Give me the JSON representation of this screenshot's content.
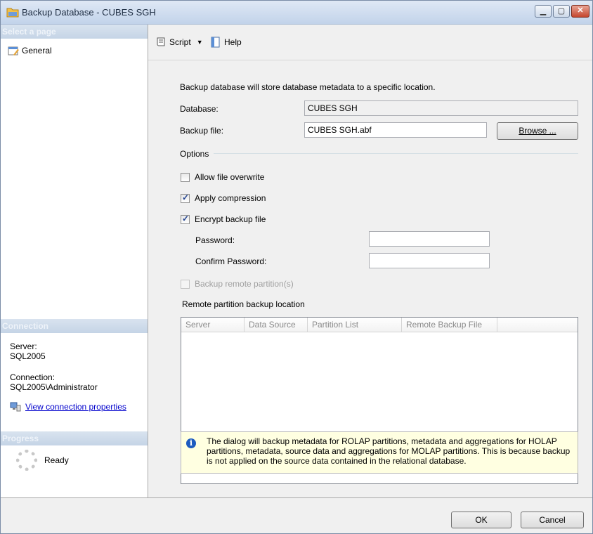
{
  "window": {
    "title": "Backup Database - CUBES SGH"
  },
  "sidebar": {
    "select_page_header": "Select a page",
    "pages": [
      {
        "label": "General"
      }
    ],
    "connection_header": "Connection",
    "server_label": "Server:",
    "server_value": "SQL2005",
    "connection_label": "Connection:",
    "connection_value": "SQL2005\\Administrator",
    "view_connection_link": "View connection properties",
    "progress_header": "Progress",
    "progress_status": "Ready"
  },
  "toolbar": {
    "script_label": "Script",
    "help_label": "Help"
  },
  "form": {
    "description": "Backup database will store database metadata to a specific location.",
    "database_label": "Database:",
    "database_value": "CUBES SGH",
    "backup_file_label": "Backup file:",
    "backup_file_value": "CUBES SGH.abf",
    "browse_label": "Browse ...",
    "options_label": "Options",
    "allow_overwrite": {
      "label": "Allow file overwrite",
      "checked": false
    },
    "apply_compression": {
      "label": "Apply compression",
      "checked": true
    },
    "encrypt_backup": {
      "label": "Encrypt backup file",
      "checked": true
    },
    "password_label": "Password:",
    "password_value": "",
    "confirm_password_label": "Confirm Password:",
    "confirm_password_value": "",
    "backup_remote": {
      "label": "Backup remote partition(s)",
      "checked": false,
      "disabled": true
    },
    "remote_location_label": "Remote partition backup location",
    "grid_columns": [
      "Server",
      "Data Source",
      "Partition List",
      "Remote Backup File"
    ],
    "info_message": "The dialog will backup metadata for ROLAP partitions, metadata and aggregations for HOLAP partitions, metadata, source data and aggregations for MOLAP partitions. This is because backup is not applied on the source data contained in the relational database."
  },
  "footer": {
    "ok_label": "OK",
    "cancel_label": "Cancel"
  },
  "colors": {
    "header_bg": "#c5d4e6",
    "link": "#0000cc",
    "info_bg": "#ffffe1"
  }
}
